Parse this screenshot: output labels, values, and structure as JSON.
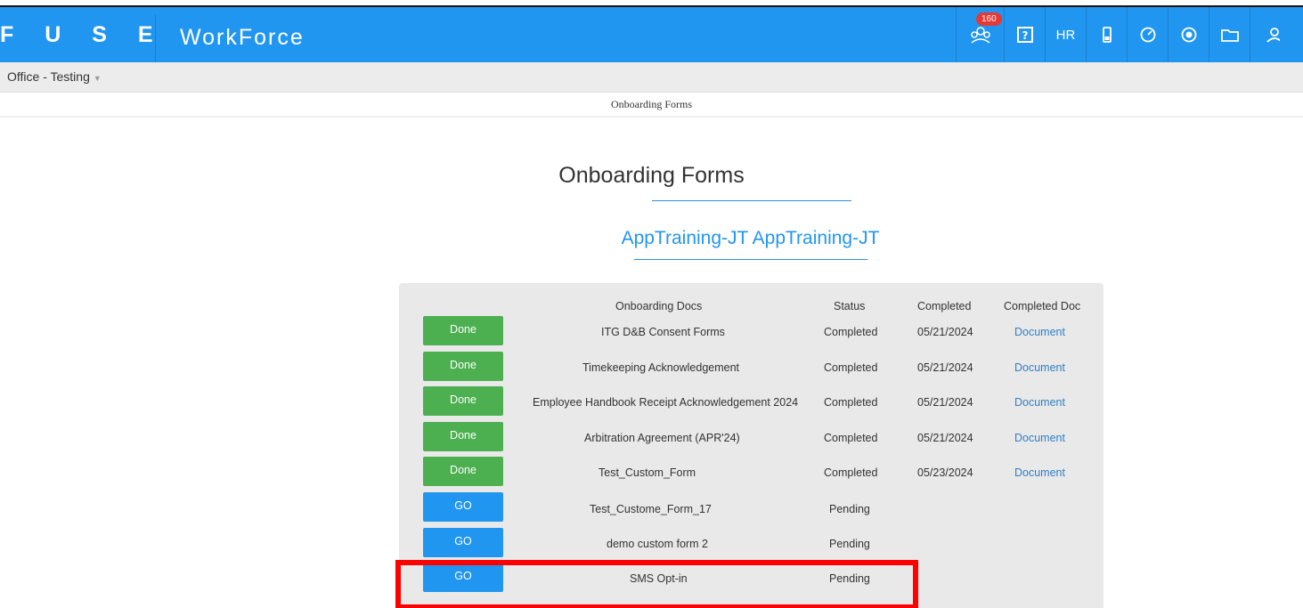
{
  "header": {
    "logo": "F U S E",
    "app_title": "WorkForce",
    "notification_count": "160",
    "hr_label": "HR"
  },
  "subbar": {
    "office": "Office - Testing"
  },
  "breadcrumb": "Onboarding Forms",
  "page": {
    "heading": "Onboarding Forms",
    "employee_name": "AppTraining-JT AppTraining-JT"
  },
  "table": {
    "headers": {
      "docs": "Onboarding Docs",
      "status": "Status",
      "completed": "Completed",
      "completed_doc": "Completed Doc"
    },
    "rows": [
      {
        "button": "Done",
        "doc": "ITG D&B Consent Forms",
        "status": "Completed",
        "date": "05/21/2024",
        "link": "Document"
      },
      {
        "button": "Done",
        "doc": "Timekeeping Acknowledgement",
        "status": "Completed",
        "date": "05/21/2024",
        "link": "Document"
      },
      {
        "button": "Done",
        "doc": "Employee Handbook Receipt Acknowledgement 2024",
        "status": "Completed",
        "date": "05/21/2024",
        "link": "Document"
      },
      {
        "button": "Done",
        "doc": "Arbitration Agreement (APR'24)",
        "status": "Completed",
        "date": "05/21/2024",
        "link": "Document"
      },
      {
        "button": "Done",
        "doc": "Test_Custom_Form",
        "status": "Completed",
        "date": "05/23/2024",
        "link": "Document"
      },
      {
        "button": "GO",
        "doc": "Test_Custome_Form_17",
        "status": "Pending"
      },
      {
        "button": "GO",
        "doc": "demo custom form 2",
        "status": "Pending"
      },
      {
        "button": "GO",
        "doc": "SMS Opt-in",
        "status": "Pending"
      }
    ]
  },
  "colors": {
    "navbar": "#2196f0",
    "done_button": "#4caf50",
    "go_button": "#2196f0",
    "highlight": "#ff0000"
  }
}
